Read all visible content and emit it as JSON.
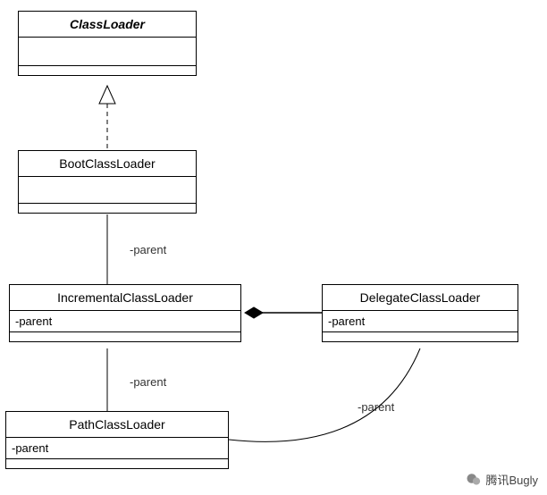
{
  "classes": {
    "classLoader": {
      "name": "ClassLoader"
    },
    "bootClassLoader": {
      "name": "BootClassLoader"
    },
    "incrementalClassLoader": {
      "name": "IncrementalClassLoader",
      "attr": "-parent"
    },
    "delegateClassLoader": {
      "name": "DelegateClassLoader",
      "attr": "-parent"
    },
    "pathClassLoader": {
      "name": "PathClassLoader",
      "attr": "-parent"
    }
  },
  "edgeLabels": {
    "bootToIncremental": "-parent",
    "incrementalToPath": "-parent",
    "pathToDelegate": "-parent"
  },
  "watermark": {
    "text": "腾讯Bugly"
  }
}
